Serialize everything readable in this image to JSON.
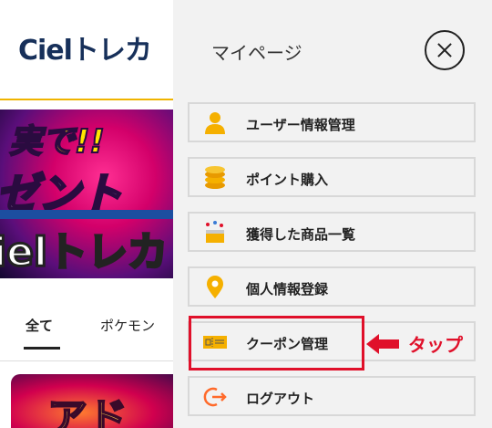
{
  "site": {
    "logo_text": "Cielトレカ",
    "banner": {
      "line1": "実で!!",
      "line2": "ゼント",
      "line3": "ielトレカ"
    },
    "tabs": [
      {
        "label": "全て",
        "active": true
      },
      {
        "label": "ポケモン",
        "active": false
      }
    ],
    "card_text": "アド"
  },
  "drawer": {
    "title": "マイページ",
    "close_icon": "close-circle-icon",
    "items": [
      {
        "label": "ユーザー情報管理",
        "icon": "user-icon"
      },
      {
        "label": "ポイント購入",
        "icon": "coins-icon"
      },
      {
        "label": "獲得した商品一覧",
        "icon": "prize-box-icon"
      },
      {
        "label": "個人情報登録",
        "icon": "location-pin-icon"
      },
      {
        "label": "クーポン管理",
        "icon": "coupon-ticket-icon"
      },
      {
        "label": "ログアウト",
        "icon": "logout-icon"
      }
    ]
  },
  "annotation": {
    "tap_label": "タップ"
  },
  "colors": {
    "accent": "#f5b000",
    "highlight": "#e0102a",
    "drawer_bg": "#f2f2f2",
    "logo": "#17305a"
  }
}
